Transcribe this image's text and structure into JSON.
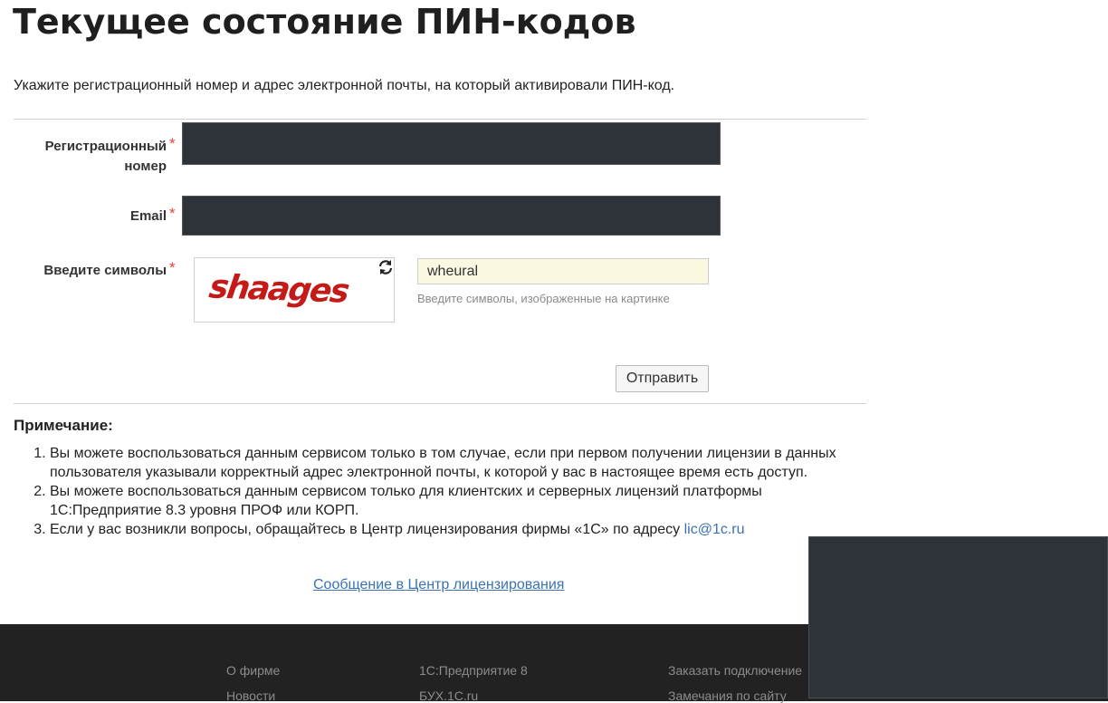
{
  "page": {
    "title": "Текущее состояние ПИН-кодов",
    "intro": "Укажите регистрационный номер и адрес электронной почты, на который активировали ПИН-код."
  },
  "form": {
    "reg_number_label_line1": "Регистрационный",
    "reg_number_label_line2": "номер",
    "email_label": "Email",
    "captcha_label": "Введите символы",
    "required_mark": "*",
    "captcha_image_text": "shaages",
    "captcha_value": "wheural",
    "captcha_hint": "Введите символы, изображенные на картинке",
    "submit_label": "Отправить",
    "refresh_icon": "refresh-icon"
  },
  "notes": {
    "title": "Примечание:",
    "items": [
      "Вы можете воспользоваться данным сервисом только в том случае, если при первом получении лицензии в данных пользователя указывали корректный адрес электронной почты, к которой у вас в настоящее время есть доступ.",
      "Вы можете воспользоваться данным сервисом только для клиентских и серверных лицензий платформы 1С:Предприятие 8.3 уровня ПРОФ или КОРП.",
      "Если у вас возникли вопросы, обращайтесь в Центр лицензирования фирмы «1С» по адресу"
    ],
    "email_link": "lic@1c.ru"
  },
  "center_link": "Сообщение в Центр лицензирования",
  "footer": {
    "col1": [
      "О фирме",
      "Новости"
    ],
    "col2": [
      "1С:Предприятие 8",
      "БУХ.1С.ru"
    ],
    "col3": [
      "Заказать подключение",
      "Замечания по сайту"
    ]
  },
  "colors": {
    "accent_link": "#3a72b2",
    "required": "#e0413a",
    "dark_field": "#2e3239",
    "captcha_input_bg": "#faf8e0",
    "footer_bg": "#222222"
  }
}
